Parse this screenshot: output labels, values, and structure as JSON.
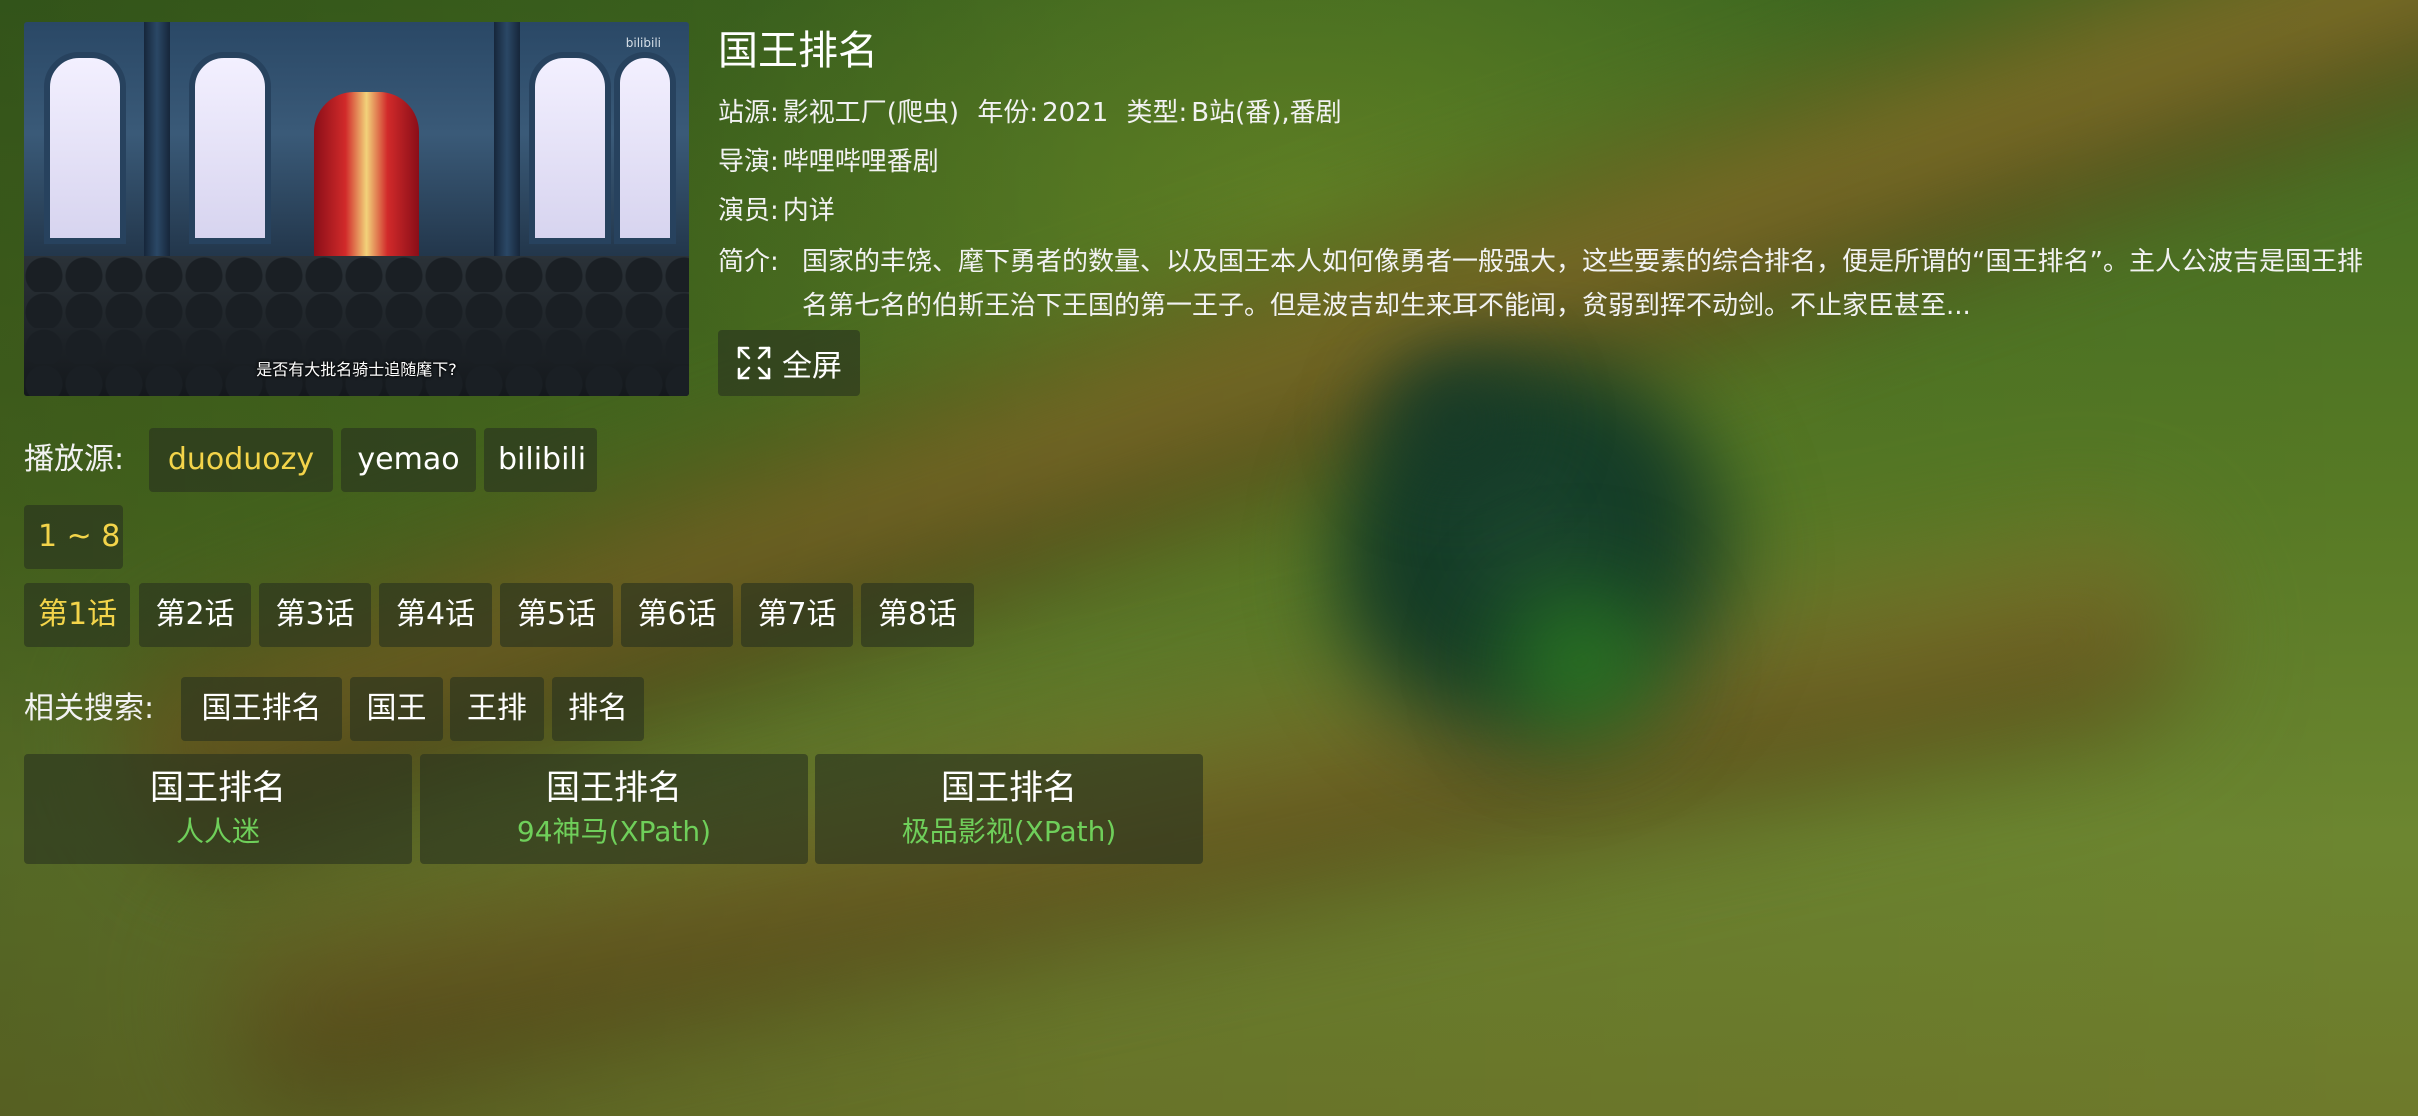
{
  "poster": {
    "subtitle": "是否有大批名骑士追随麾下?",
    "logo_text": "bilibili"
  },
  "detail": {
    "title": "国王排名",
    "site_label": "站源:",
    "site_value": "影视工厂(爬虫)",
    "year_label": "年份:",
    "year_value": "2021",
    "type_label": "类型:",
    "type_value": "B站(番),番剧",
    "director_label": "导演:",
    "director_value": "哔哩哔哩番剧",
    "actor_label": "演员:",
    "actor_value": "内详",
    "desc_label": "简介:",
    "desc_value": "国家的丰饶、麾下勇者的数量、以及国王本人如何像勇者一般强大，这些要素的综合排名，便是所谓的“国王排名”。主人公波吉是国王排名第七名的伯斯王治下王国的第一王子。但是波吉却生来耳不能闻，贫弱到挥不动剑。不止家臣甚至..."
  },
  "fullscreen": {
    "label": "全屏",
    "icon": "expand-icon"
  },
  "sources": {
    "label": "播放源:",
    "items": [
      "duoduozy",
      "yemao",
      "bilibili"
    ],
    "active": "duoduozy"
  },
  "range": {
    "label": "1 ~ 8"
  },
  "episodes": {
    "items": [
      "第1话",
      "第2话",
      "第3话",
      "第4话",
      "第5话",
      "第6话",
      "第7话",
      "第8话"
    ],
    "active": "第1话"
  },
  "related": {
    "label": "相关搜索:",
    "items": [
      "国王排名",
      "国王",
      "王排",
      "排名"
    ]
  },
  "results": [
    {
      "title": "国王排名",
      "source": "人人迷"
    },
    {
      "title": "国王排名",
      "source": "94神马(XPath)"
    },
    {
      "title": "国王排名",
      "source": "极品影视(XPath)"
    }
  ],
  "colors": {
    "accent_active": "#f3d44a",
    "source_green": "#6fcf5a",
    "chip_bg": "rgba(40,50,30,0.62)"
  }
}
